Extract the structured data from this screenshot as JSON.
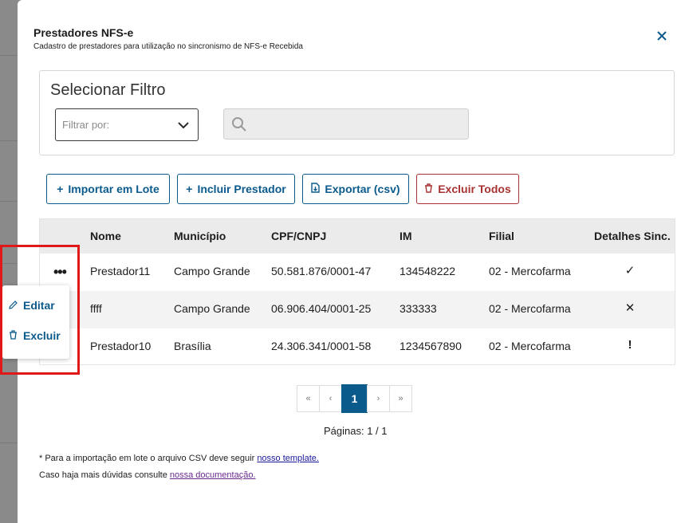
{
  "modal": {
    "title": "Prestadores NFS-e",
    "subtitle": "Cadastro de prestadores para utilização no sincronismo de NFS-e Recebida",
    "close_icon": "close-icon"
  },
  "filter": {
    "title": "Selecionar Filtro",
    "select_placeholder": "Filtrar por:",
    "search_value": ""
  },
  "toolbar": {
    "import_label": "Importar em Lote",
    "include_label": "Incluir Prestador",
    "export_label": "Exportar (csv)",
    "delete_all_label": "Excluir Todos"
  },
  "table": {
    "headers": [
      "Nome",
      "Município",
      "CPF/CNPJ",
      "IM",
      "Filial",
      "Detalhes Sinc."
    ],
    "rows": [
      {
        "nome": "Prestador11",
        "municipio": "Campo Grande",
        "cnpj": "50.581.876/0001-47",
        "im": "134548222",
        "filial": "02 - Mercofarma",
        "sync": "✓",
        "sync_icon": "check-icon"
      },
      {
        "nome": "ffff",
        "municipio": "Campo Grande",
        "cnpj": "06.906.404/0001-25",
        "im": "333333",
        "filial": "02 - Mercofarma",
        "sync": "✕",
        "sync_icon": "x-icon"
      },
      {
        "nome": "Prestador10",
        "municipio": "Brasília",
        "cnpj": "24.306.341/0001-58",
        "im": "1234567890",
        "filial": "02 - Mercofarma",
        "sync": "!",
        "sync_icon": "exclamation-icon"
      }
    ],
    "row_menu": "•••"
  },
  "context_menu": {
    "edit_label": "Editar",
    "delete_label": "Excluir"
  },
  "pagination": {
    "first": "«",
    "prev": "‹",
    "current": "1",
    "next": "›",
    "last": "»",
    "label": "Páginas: 1 / 1"
  },
  "notes": {
    "csv_text": "* Para a importação em lote o arquivo CSV deve seguir ",
    "csv_link": "nosso template.",
    "doc_text": "Caso haja mais dúvidas consulte ",
    "doc_link": "nossa documentação."
  },
  "colors": {
    "primary": "#0b5a8c",
    "danger": "#a83232",
    "highlight": "#e01818"
  }
}
